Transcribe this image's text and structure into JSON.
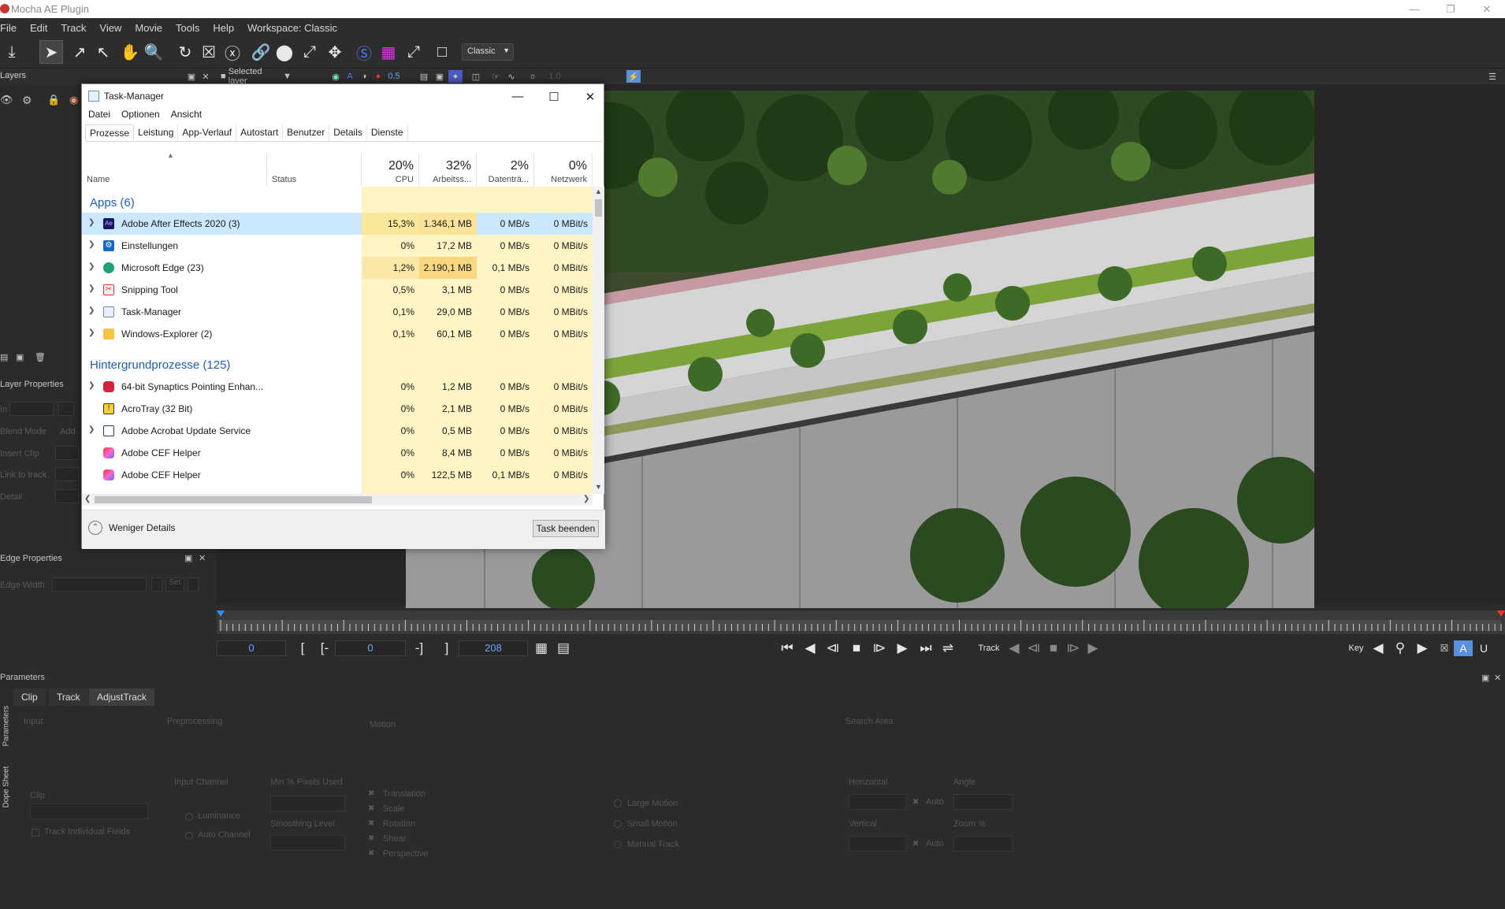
{
  "window": {
    "title": "Mocha AE Plugin"
  },
  "menu": [
    "File",
    "Edit",
    "Track",
    "View",
    "Movie",
    "Tools",
    "Help"
  ],
  "workspace_label": "Workspace: Classic",
  "toolbar": {
    "workspace_select": "Classic"
  },
  "layers_panel": {
    "title": "Layers",
    "layer_select": "Selected layer",
    "zoom_value": "0.5",
    "exposure_value": "1.0"
  },
  "layer_properties": {
    "title": "Layer Properties",
    "in_label": "In",
    "blend_mode_label": "Blend Mode",
    "blend_mode_button": "Add",
    "insert_clip_label": "Insert Clip",
    "link_to_track_label": "Link to track",
    "detail_label": "Detail"
  },
  "edge_properties": {
    "title": "Edge Properties",
    "edge_width_label": "Edge Width",
    "set_button": "Set"
  },
  "timeline": {
    "in_frame": "0",
    "in_marker": "0",
    "out_frame": "208"
  },
  "playback": {
    "track_label": "Track",
    "key_label": "Key"
  },
  "parameters": {
    "title": "Parameters",
    "tabs": [
      "Clip",
      "Track",
      "AdjustTrack"
    ],
    "side_tabs": [
      "Parameters",
      "Dope Sheet"
    ],
    "sections": {
      "input": "Input",
      "preprocessing": "Preprocessing",
      "motion": "Motion",
      "search_area": "Search Area"
    },
    "clip_label": "Clip",
    "track_individual_fields": "Track Individual Fields",
    "input_channel": "Input Channel",
    "luminance": "Luminance",
    "auto_channel": "Auto Channel",
    "min_pixels_used": "Min % Pixels Used",
    "smoothing_level": "Smoothing Level",
    "motion_options": [
      "Translation",
      "Scale",
      "Rotation",
      "Shear",
      "Perspective"
    ],
    "motion_types": [
      "Large Motion",
      "Small Motion",
      "Manual Track"
    ],
    "horizontal": "Horizontal",
    "vertical": "Vertical",
    "angle": "Angle",
    "zoom": "Zoom %",
    "auto": "Auto"
  },
  "task_manager": {
    "title": "Task-Manager",
    "menu": [
      "Datei",
      "Optionen",
      "Ansicht"
    ],
    "tabs": [
      "Prozesse",
      "Leistung",
      "App-Verlauf",
      "Autostart",
      "Benutzer",
      "Details",
      "Dienste"
    ],
    "columns": {
      "name": "Name",
      "status": "Status",
      "cpu_pct": "20%",
      "cpu": "CPU",
      "mem_pct": "32%",
      "mem": "Arbeitss...",
      "disk_pct": "2%",
      "disk": "Datenträ...",
      "net_pct": "0%",
      "net": "Netzwerk"
    },
    "groups": {
      "apps": "Apps (6)",
      "background": "Hintergrundprozesse (125)"
    },
    "apps": [
      {
        "name": "Adobe After Effects 2020 (3)",
        "cpu": "15,3%",
        "mem": "1.346,1 MB",
        "disk": "0 MB/s",
        "net": "0 MBit/s"
      },
      {
        "name": "Einstellungen",
        "cpu": "0%",
        "mem": "17,2 MB",
        "disk": "0 MB/s",
        "net": "0 MBit/s"
      },
      {
        "name": "Microsoft Edge (23)",
        "cpu": "1,2%",
        "mem": "2.190,1 MB",
        "disk": "0,1 MB/s",
        "net": "0 MBit/s"
      },
      {
        "name": "Snipping Tool",
        "cpu": "0,5%",
        "mem": "3,1 MB",
        "disk": "0 MB/s",
        "net": "0 MBit/s"
      },
      {
        "name": "Task-Manager",
        "cpu": "0,1%",
        "mem": "29,0 MB",
        "disk": "0 MB/s",
        "net": "0 MBit/s"
      },
      {
        "name": "Windows-Explorer (2)",
        "cpu": "0,1%",
        "mem": "60,1 MB",
        "disk": "0 MB/s",
        "net": "0 MBit/s"
      }
    ],
    "background": [
      {
        "name": "64-bit Synaptics Pointing Enhan...",
        "cpu": "0%",
        "mem": "1,2 MB",
        "disk": "0 MB/s",
        "net": "0 MBit/s"
      },
      {
        "name": "AcroTray (32 Bit)",
        "cpu": "0%",
        "mem": "2,1 MB",
        "disk": "0 MB/s",
        "net": "0 MBit/s"
      },
      {
        "name": "Adobe Acrobat Update Service",
        "cpu": "0%",
        "mem": "0,5 MB",
        "disk": "0 MB/s",
        "net": "0 MBit/s"
      },
      {
        "name": "Adobe CEF Helper",
        "cpu": "0%",
        "mem": "8,4 MB",
        "disk": "0 MB/s",
        "net": "0 MBit/s"
      },
      {
        "name": "Adobe CEF Helper",
        "cpu": "0%",
        "mem": "122,5 MB",
        "disk": "0,1 MB/s",
        "net": "0 MBit/s"
      }
    ],
    "footer": {
      "fewer_details": "Weniger Details",
      "end_task": "Task beenden"
    }
  }
}
